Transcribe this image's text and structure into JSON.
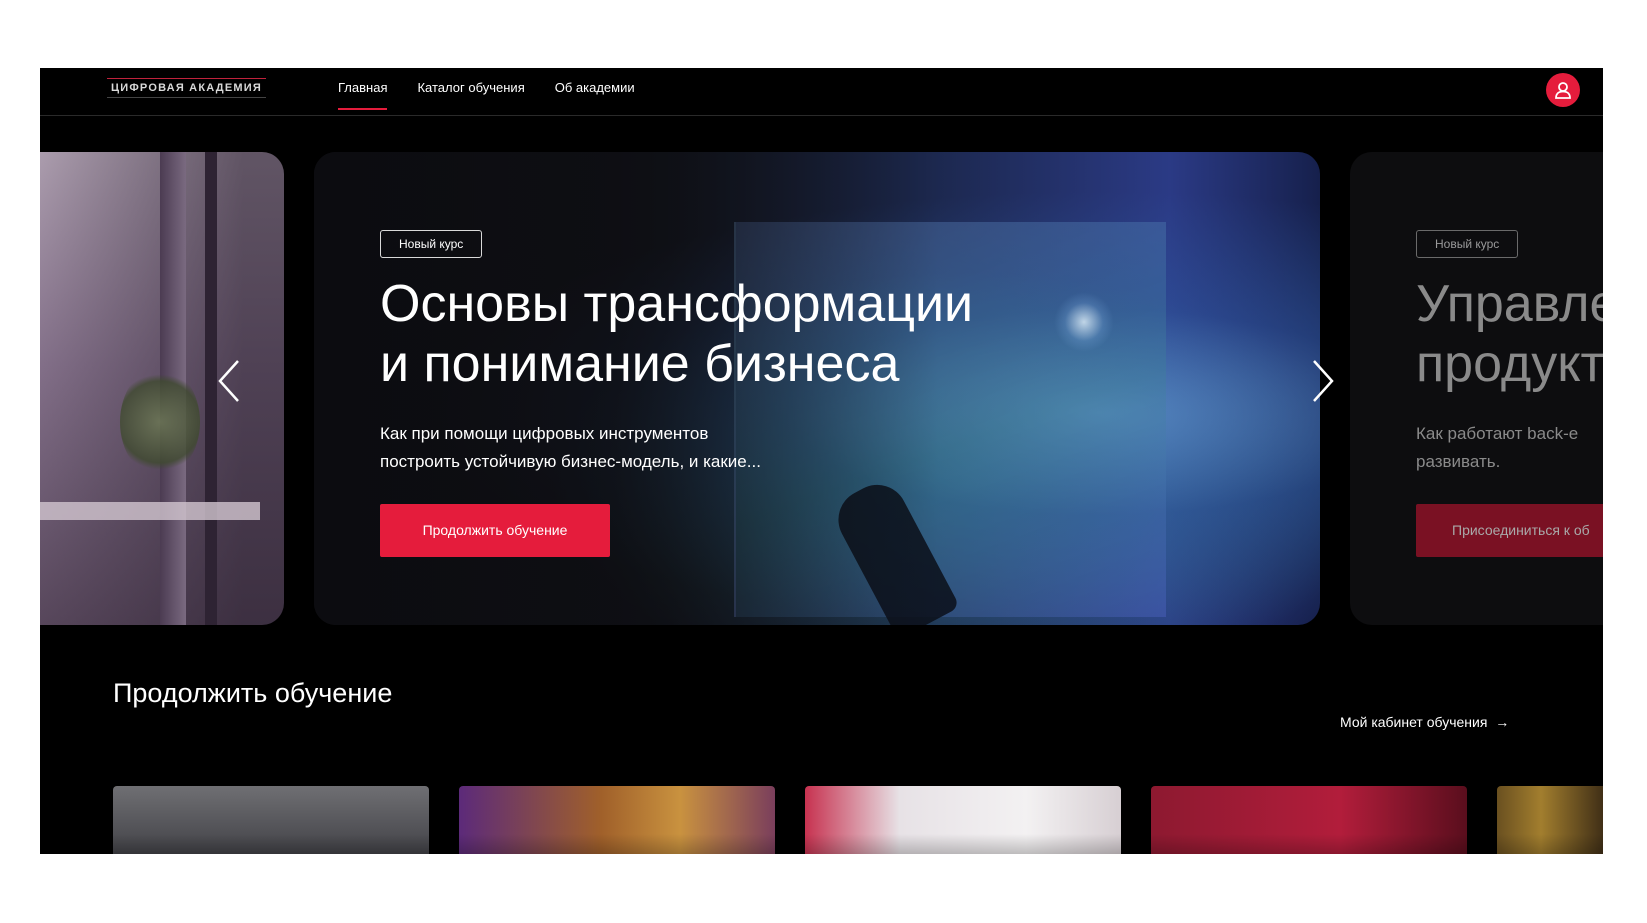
{
  "header": {
    "logo": "ЦИФРОВАЯ АКАДЕМИЯ",
    "nav": [
      {
        "label": "Главная",
        "active": true
      },
      {
        "label": "Каталог обучения",
        "active": false
      },
      {
        "label": "Об академии",
        "active": false
      }
    ],
    "profile_icon": "user-icon"
  },
  "carousel": {
    "current": {
      "tag": "Новый курс",
      "title_line1": "Основы трансформации",
      "title_line2": "и понимание бизнеса",
      "desc_line1": "Как при помощи цифровых инструментов",
      "desc_line2": "построить устойчивую бизнес-модель, и какие...",
      "cta": "Продолжить обучение"
    },
    "next": {
      "tag": "Новый курс",
      "title_line1": "Управле",
      "title_line2": "продукт",
      "desc_line1": "Как работают back-e",
      "desc_line2": "развивать.",
      "cta": "Присоединиться к об"
    },
    "prev_icon": "chevron-left-icon",
    "next_icon": "chevron-right-icon"
  },
  "continue": {
    "title": "Продолжить обучение",
    "link": "Мой кабинет обучения",
    "link_icon": "arrow-right-icon"
  },
  "colors": {
    "accent": "#e51c3c",
    "background": "#000000"
  }
}
